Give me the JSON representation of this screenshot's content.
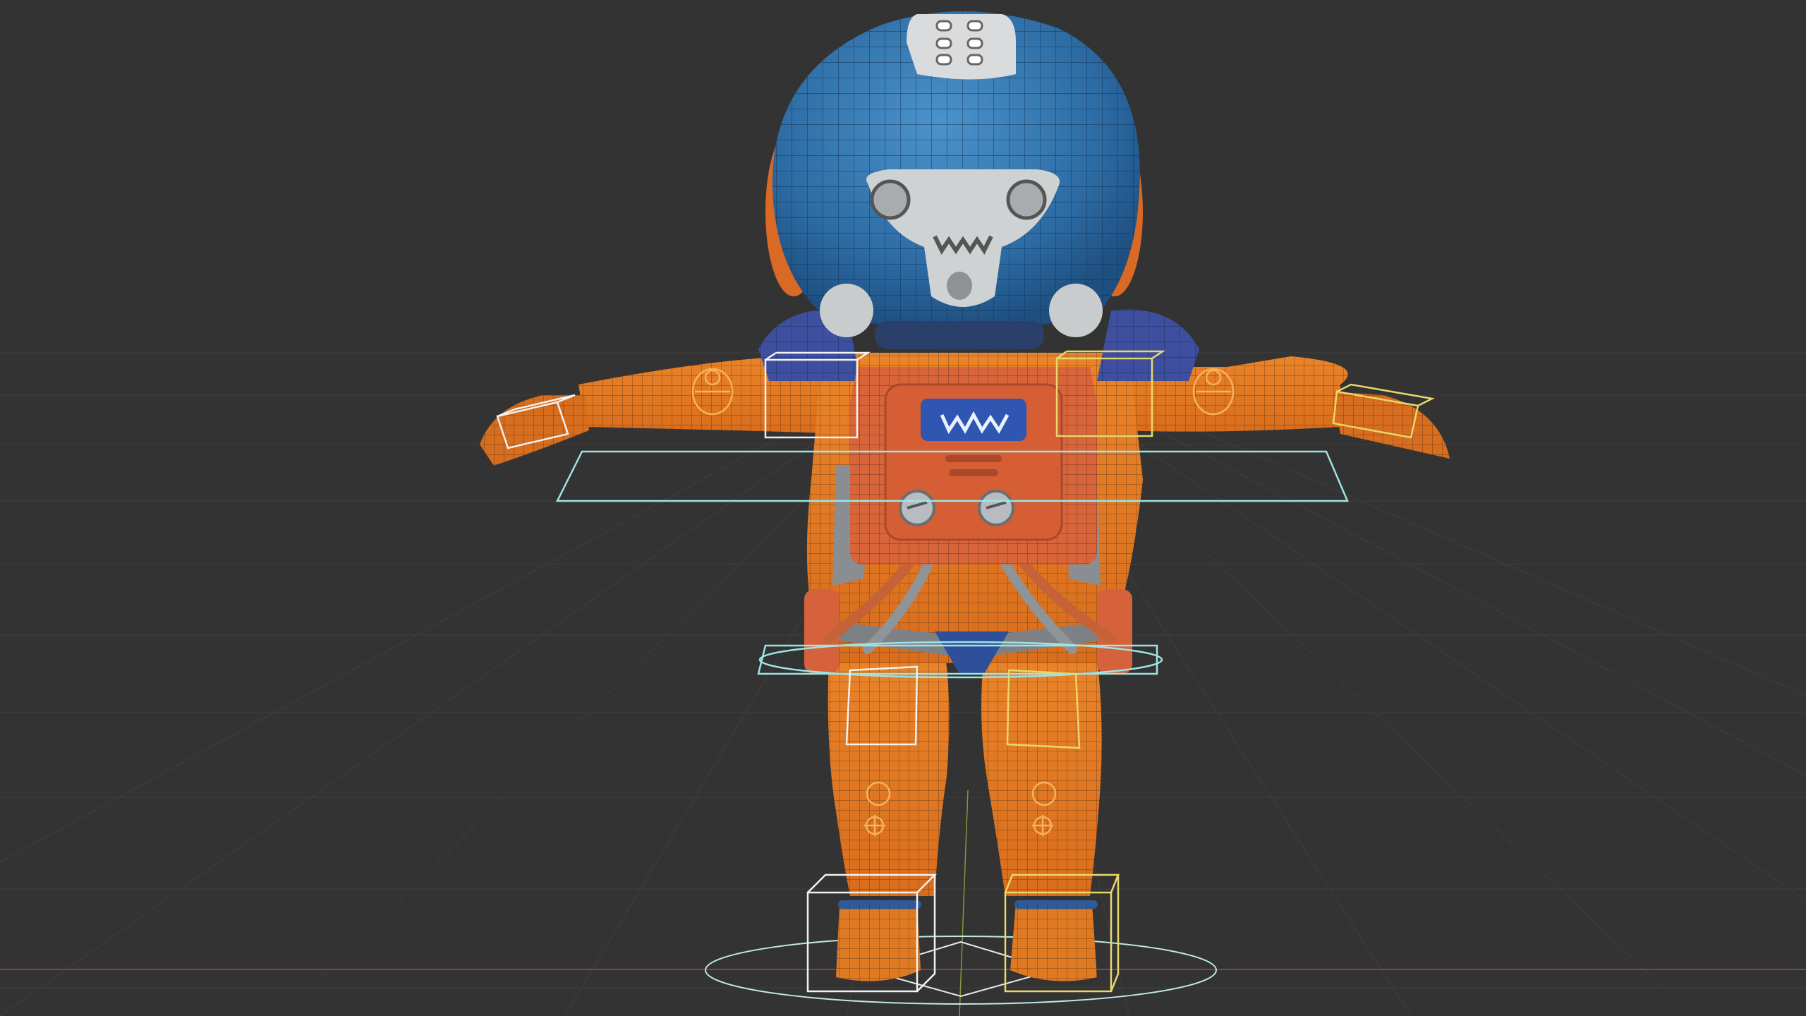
{
  "viewport": {
    "name": "3d-viewport",
    "background": "#333333",
    "grid_color": "#3e3e3e",
    "x_axis_color": "#9a3b45",
    "y_axis_color": "#7f9a3a"
  },
  "character": {
    "name": "astronaut-character",
    "suit_color": "#e07a22",
    "helmet_color": "#2f6fa8",
    "armor_color": "#3f4fa0",
    "chest_color": "#d8643a",
    "visor_color": "#cfd2d3",
    "wire_color": "#1a1a1a"
  },
  "rig": {
    "controls_white": "#f2f2f2",
    "controls_yellow": "#e9d86a",
    "controls_cyan": "#9fe3e3",
    "controls_orange": "#f4b25c"
  }
}
